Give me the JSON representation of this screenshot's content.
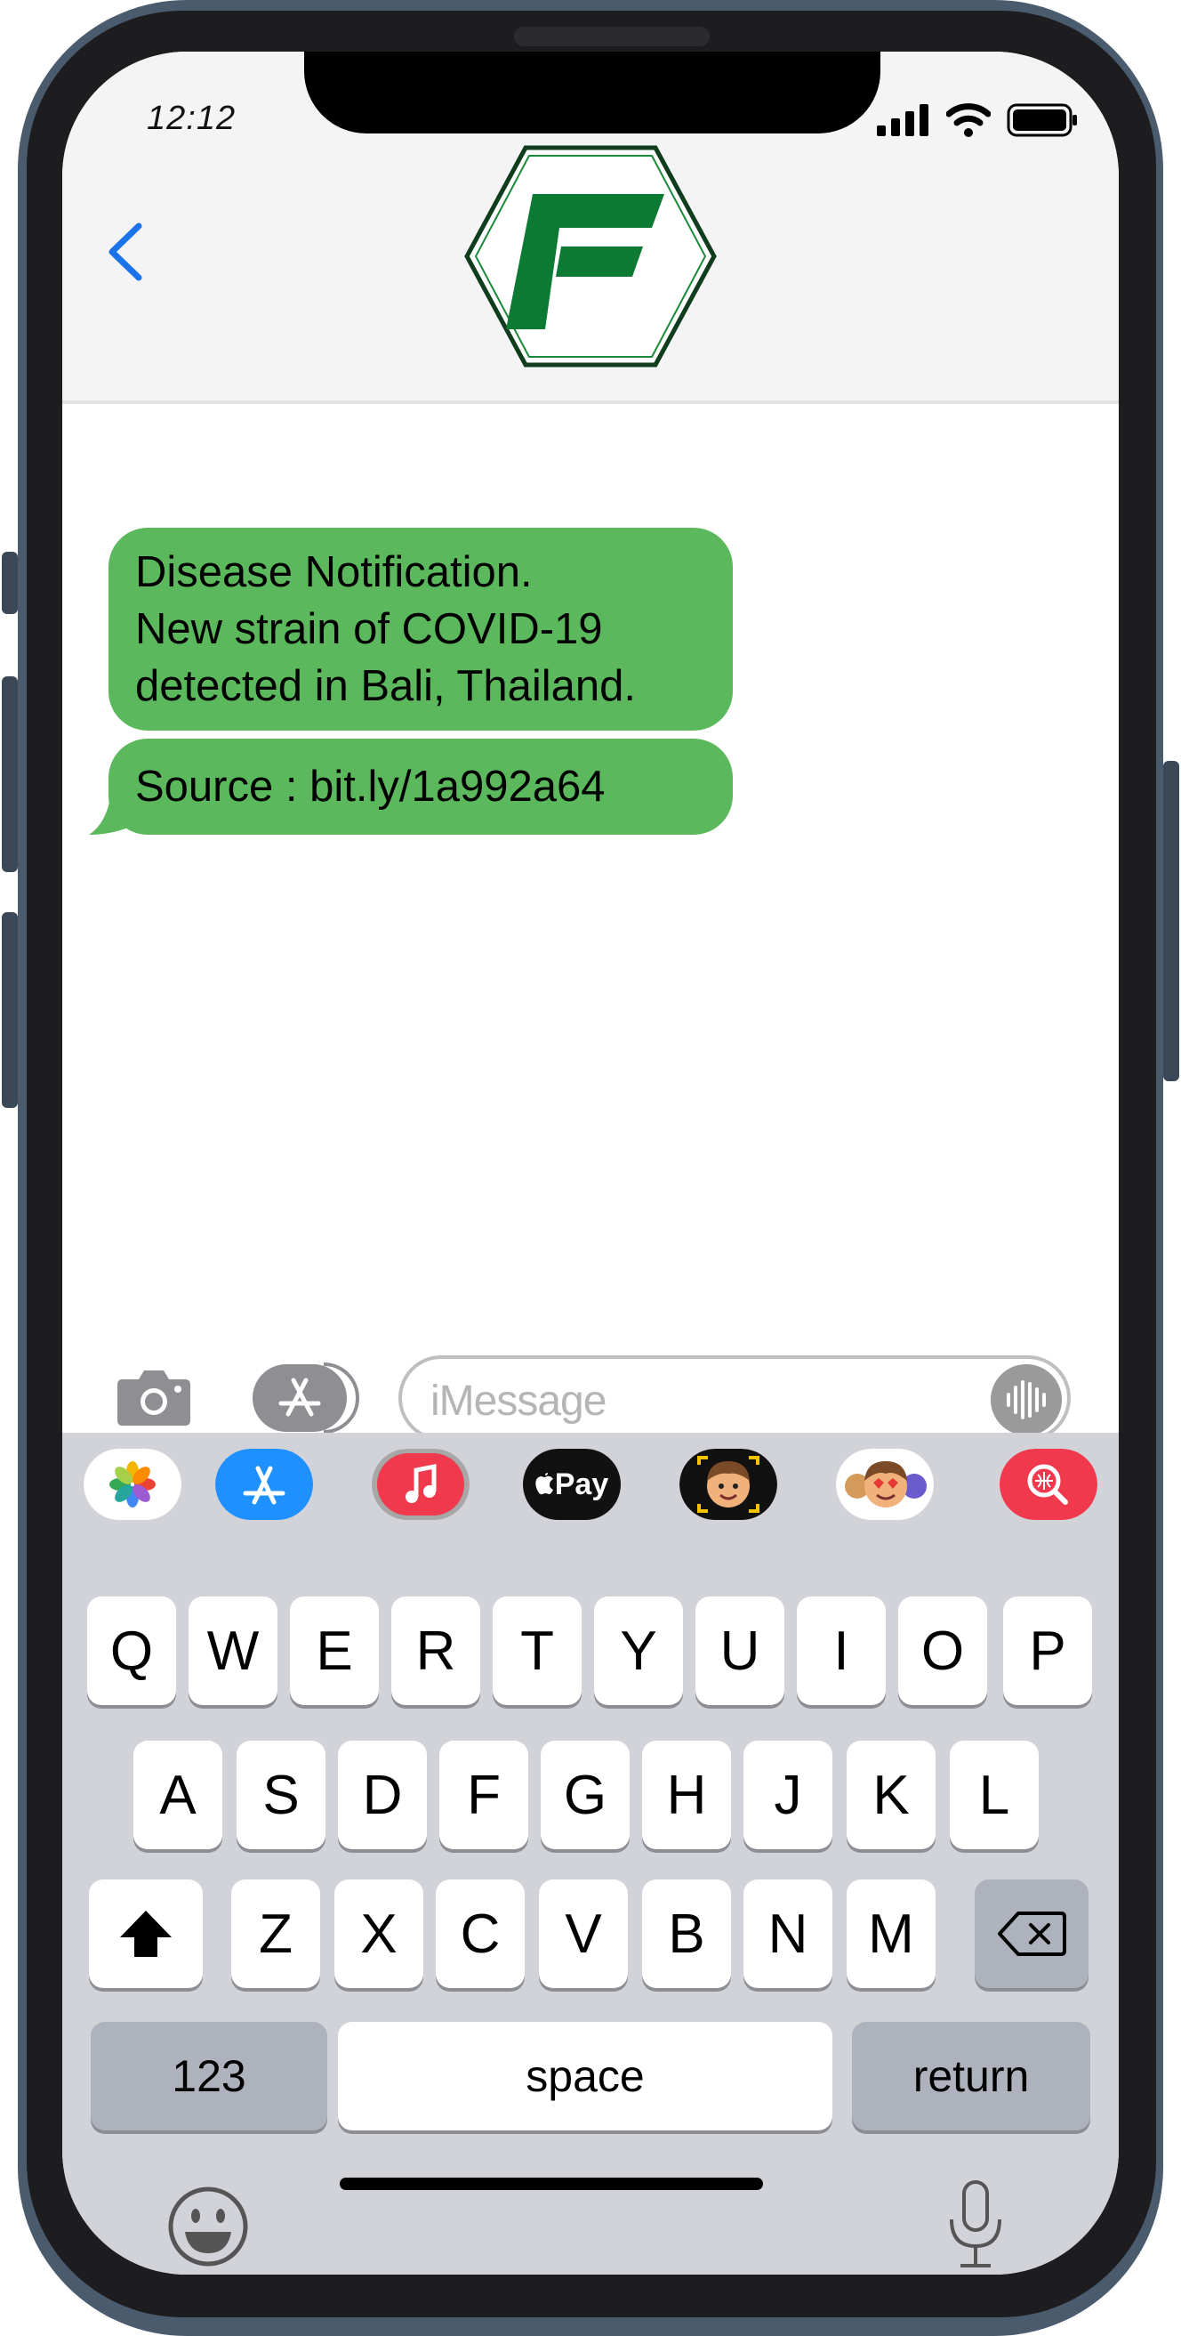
{
  "status_bar": {
    "time": "12:12"
  },
  "header": {
    "back_icon": "chevron-left-icon",
    "logo": "green-hexagon-f-logo",
    "accent": "#1a73e8"
  },
  "messages": [
    {
      "lines": [
        "Disease Notification.",
        "New strain of COVID-19",
        "detected in Bali, Thailand."
      ]
    },
    {
      "lines": [
        "Source : bit.ly/1a992a64"
      ]
    }
  ],
  "bubble_color": "#5cb85c",
  "input": {
    "placeholder": "iMessage"
  },
  "app_strip": [
    "photos-icon",
    "app-store-icon",
    "music-icon",
    "apple-pay-icon",
    "memoji-icon",
    "memoji-stickers-icon",
    "search-images-icon"
  ],
  "apple_pay_label": "Pay",
  "keyboard": {
    "row1": [
      "Q",
      "W",
      "E",
      "R",
      "T",
      "Y",
      "U",
      "I",
      "O",
      "P"
    ],
    "row2": [
      "A",
      "S",
      "D",
      "F",
      "G",
      "H",
      "J",
      "K",
      "L"
    ],
    "row3": [
      "Z",
      "X",
      "C",
      "V",
      "B",
      "N",
      "M"
    ],
    "numbers_label": "123",
    "space_label": "space",
    "return_label": "return"
  }
}
